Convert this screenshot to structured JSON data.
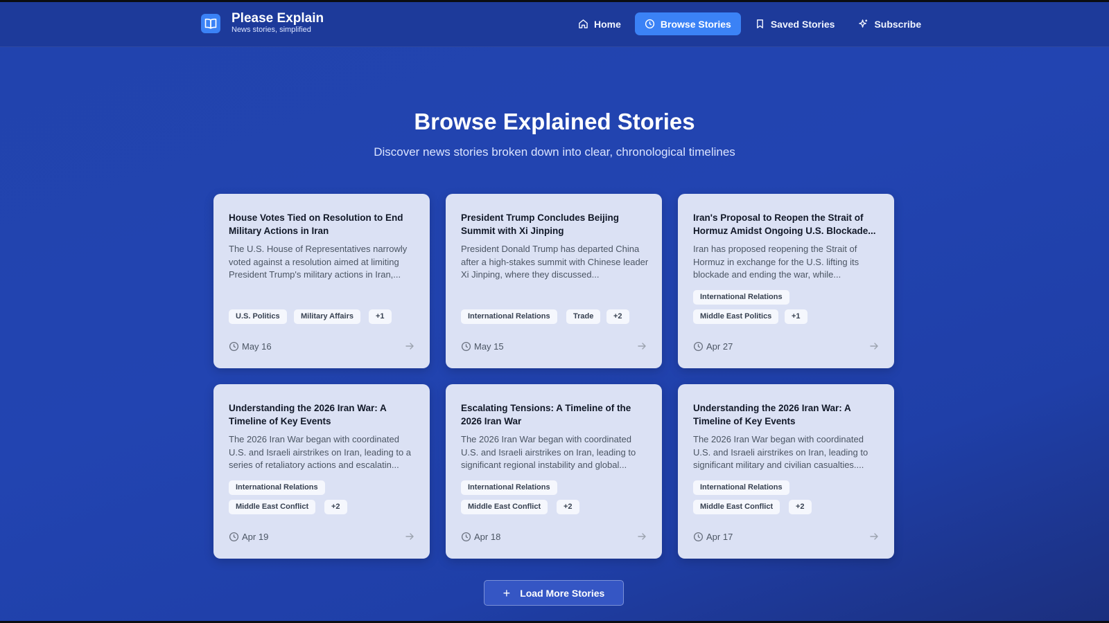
{
  "app": {
    "title": "Please Explain",
    "subtitle": "News stories, simplified"
  },
  "nav": {
    "home": "Home",
    "browse": "Browse Stories",
    "saved": "Saved Stories",
    "subscribe": "Subscribe"
  },
  "hero": {
    "title": "Browse Explained Stories",
    "subtitle": "Discover news stories broken down into clear, chronological timelines"
  },
  "stories": [
    {
      "title": "House Votes Tied on Resolution to End Military Actions in Iran",
      "description": "The U.S. House of Representatives narrowly voted against a resolution aimed at limiting President Trump's military actions in Iran,...",
      "tags": [
        "U.S. Politics",
        "Military Affairs",
        "+1"
      ],
      "date": "May 16"
    },
    {
      "title": "President Trump Concludes Beijing Summit with Xi Jinping",
      "description": "President Donald Trump has departed China after a high-stakes summit with Chinese leader Xi Jinping, where they discussed...",
      "tags": [
        "International Relations",
        "Trade",
        "+2"
      ],
      "date": "May 15"
    },
    {
      "title": "Iran's Proposal to Reopen the Strait of Hormuz Amidst Ongoing U.S. Blockade...",
      "description": "Iran has proposed reopening the Strait of Hormuz in exchange for the U.S. lifting its blockade and ending the war, while...",
      "tags": [
        "International Relations",
        "Middle East Politics",
        "+1"
      ],
      "date": "Apr 27"
    },
    {
      "title": "Understanding the 2026 Iran War: A Timeline of Key Events",
      "description": "The 2026 Iran War began with coordinated U.S. and Israeli airstrikes on Iran, leading to a series of retaliatory actions and escalatin...",
      "tags": [
        "International Relations",
        "Middle East Conflict",
        "+2"
      ],
      "date": "Apr 19"
    },
    {
      "title": "Escalating Tensions: A Timeline of the 2026 Iran War",
      "description": "The 2026 Iran War began with coordinated U.S. and Israeli airstrikes on Iran, leading to significant regional instability and global...",
      "tags": [
        "International Relations",
        "Middle East Conflict",
        "+2"
      ],
      "date": "Apr 18"
    },
    {
      "title": "Understanding the 2026 Iran War: A Timeline of Key Events",
      "description": "The 2026 Iran War began with coordinated U.S. and Israeli airstrikes on Iran, leading to significant military and civilian casualties....",
      "tags": [
        "International Relations",
        "Middle East Conflict",
        "+2"
      ],
      "date": "Apr 17"
    }
  ],
  "load_more": "Load More Stories",
  "colors": {
    "accent": "#3b82f6",
    "background": "#2244b1",
    "card": "#dbe1f4"
  },
  "icons": {
    "logo": "book-open-icon",
    "home": "home-icon",
    "browse": "clock-icon",
    "saved": "bookmark-icon",
    "subscribe": "sparkle-icon",
    "date": "clock-icon",
    "open": "arrow-right-icon",
    "load_more": "plus-icon"
  }
}
